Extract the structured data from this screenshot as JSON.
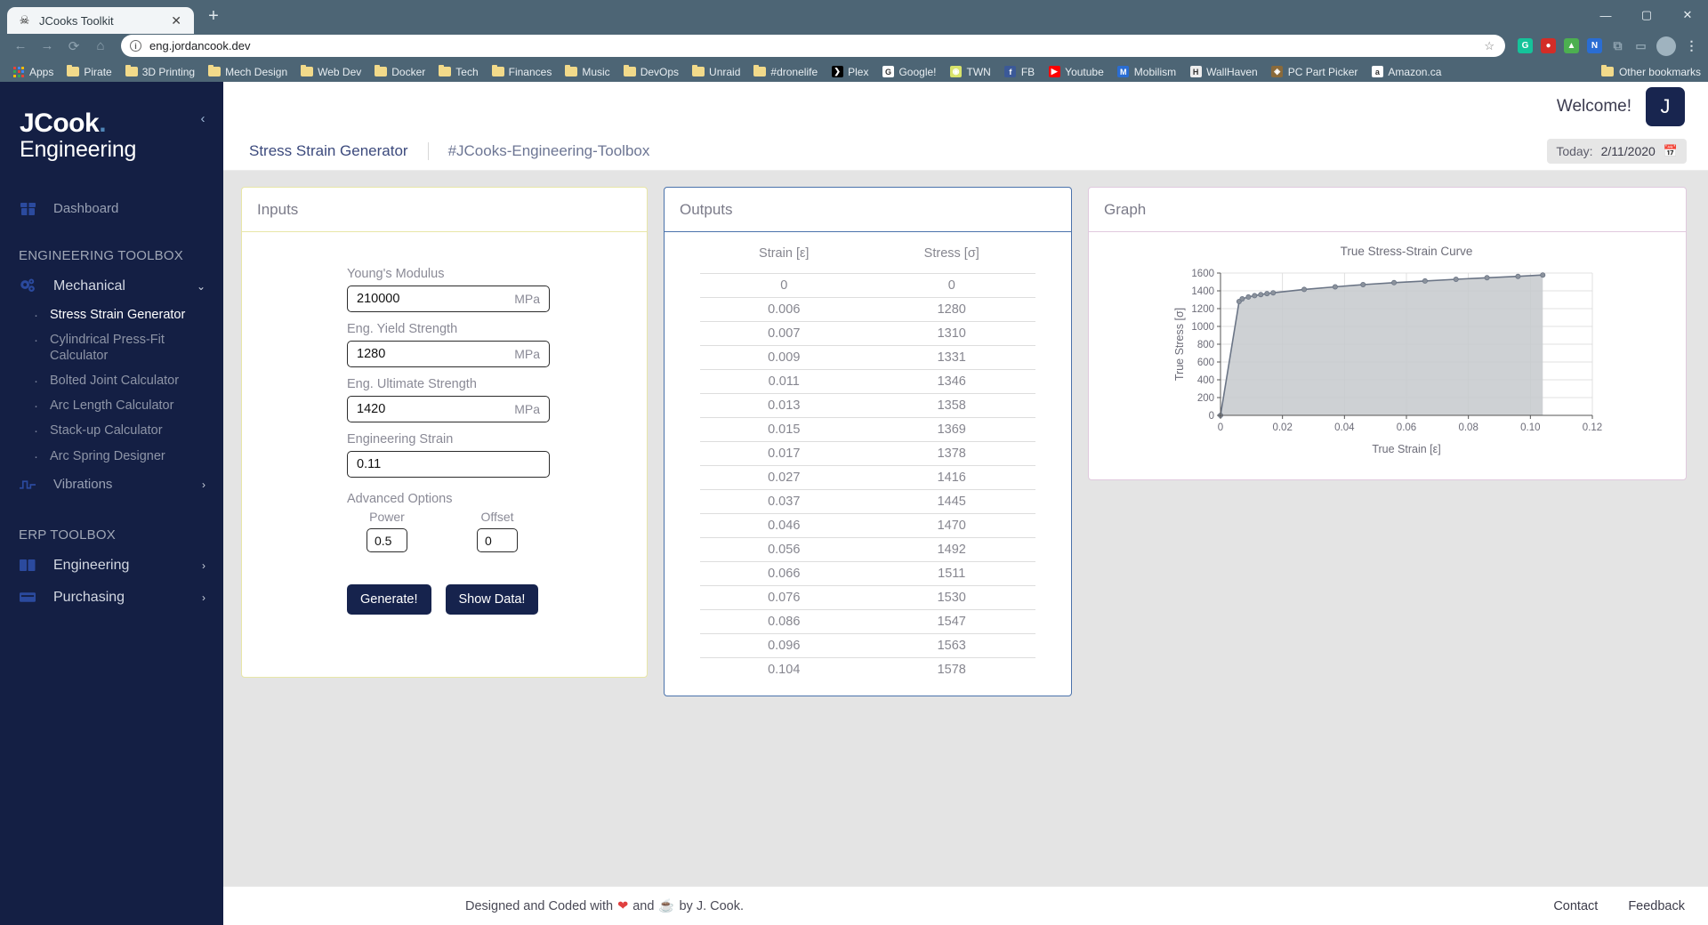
{
  "browser": {
    "tab": {
      "title": "JCooks Toolkit",
      "favicon": "skull-icon",
      "close": "✕"
    },
    "newtab_label": "+",
    "window_controls": [
      "minimize",
      "maximize",
      "close"
    ],
    "nav": {
      "back": "←",
      "forward": "→",
      "reload": "⟳",
      "home": "⌂"
    },
    "omnibox": {
      "url": "eng.jordancook.dev",
      "info_icon": "info-icon",
      "star": "☆"
    },
    "extensions": [
      "grammarly-icon",
      "lastpass-icon",
      "adblock-icon",
      "office-icon",
      "puzzle-icon",
      "cast-icon"
    ],
    "profile": "profile-avatar",
    "bookmarks": [
      {
        "label": "Apps",
        "icon": "apps-grid-icon"
      },
      {
        "label": "Pirate",
        "icon": "folder-icon"
      },
      {
        "label": "3D Printing",
        "icon": "folder-icon"
      },
      {
        "label": "Mech Design",
        "icon": "folder-icon"
      },
      {
        "label": "Web Dev",
        "icon": "folder-icon"
      },
      {
        "label": "Docker",
        "icon": "folder-icon"
      },
      {
        "label": "Tech",
        "icon": "folder-icon"
      },
      {
        "label": "Finances",
        "icon": "folder-icon"
      },
      {
        "label": "Music",
        "icon": "folder-icon"
      },
      {
        "label": "DevOps",
        "icon": "folder-icon"
      },
      {
        "label": "Unraid",
        "icon": "folder-icon"
      },
      {
        "label": "#dronelife",
        "icon": "folder-icon"
      },
      {
        "label": "Plex",
        "icon": "plex-icon"
      },
      {
        "label": "Google!",
        "icon": "google-icon"
      },
      {
        "label": "TWN",
        "icon": "twn-icon"
      },
      {
        "label": "FB",
        "icon": "facebook-icon"
      },
      {
        "label": "Youtube",
        "icon": "youtube-icon"
      },
      {
        "label": "Mobilism",
        "icon": "mobilism-icon"
      },
      {
        "label": "WallHaven",
        "icon": "wallhaven-icon"
      },
      {
        "label": "PC Part Picker",
        "icon": "pcpartpicker-icon"
      },
      {
        "label": "Amazon.ca",
        "icon": "amazon-icon"
      }
    ],
    "other_bookmarks": {
      "label": "Other bookmarks",
      "icon": "folder-icon"
    }
  },
  "sidebar": {
    "logo_line1": "JCook",
    "logo_dot": ".",
    "logo_line2": "Engineering",
    "collapse_icon": "chevron-left-icon",
    "dashboard": {
      "label": "Dashboard",
      "icon": "dashboard-icon"
    },
    "section_engineering": "ENGINEERING TOOLBOX",
    "mechanical": {
      "label": "Mechanical",
      "icon": "gears-icon",
      "chevron": "chevron-down-icon"
    },
    "mechanical_items": [
      "Stress Strain Generator",
      "Cylindrical Press-Fit Calculator",
      "Bolted Joint Calculator",
      "Arc Length Calculator",
      "Stack-up Calculator",
      "Arc Spring Designer"
    ],
    "vibrations": {
      "label": "Vibrations",
      "icon": "waveform-icon",
      "chevron": "chevron-right-icon"
    },
    "section_erp": "ERP TOOLBOX",
    "engineering": {
      "label": "Engineering",
      "icon": "book-icon",
      "chevron": "chevron-right-icon"
    },
    "purchasing": {
      "label": "Purchasing",
      "icon": "cart-icon",
      "chevron": "chevron-right-icon"
    }
  },
  "topbar": {
    "welcome": "Welcome!",
    "avatar_initial": "J"
  },
  "apptabs": {
    "primary": "Stress Strain Generator",
    "secondary": "#JCooks-Engineering-Toolbox",
    "today_label": "Today:",
    "today_value": "2/11/2020",
    "calendar_icon": "calendar-icon"
  },
  "inputs": {
    "title": "Inputs",
    "fields": [
      {
        "label": "Young's Modulus",
        "value": "210000",
        "unit": "MPa"
      },
      {
        "label": "Eng. Yield Strength",
        "value": "1280",
        "unit": "MPa"
      },
      {
        "label": "Eng. Ultimate Strength",
        "value": "1420",
        "unit": "MPa"
      },
      {
        "label": "Engineering Strain",
        "value": "0.11",
        "unit": ""
      }
    ],
    "advanced_label": "Advanced Options",
    "power": {
      "label": "Power",
      "value": "0.5"
    },
    "offset": {
      "label": "Offset",
      "value": "0"
    },
    "generate_btn": "Generate!",
    "showdata_btn": "Show Data!"
  },
  "outputs": {
    "title": "Outputs",
    "columns": [
      "Strain [ε]",
      "Stress [σ]"
    ],
    "rows": [
      [
        "0",
        "0"
      ],
      [
        "0.006",
        "1280"
      ],
      [
        "0.007",
        "1310"
      ],
      [
        "0.009",
        "1331"
      ],
      [
        "0.011",
        "1346"
      ],
      [
        "0.013",
        "1358"
      ],
      [
        "0.015",
        "1369"
      ],
      [
        "0.017",
        "1378"
      ],
      [
        "0.027",
        "1416"
      ],
      [
        "0.037",
        "1445"
      ],
      [
        "0.046",
        "1470"
      ],
      [
        "0.056",
        "1492"
      ],
      [
        "0.066",
        "1511"
      ],
      [
        "0.076",
        "1530"
      ],
      [
        "0.086",
        "1547"
      ],
      [
        "0.096",
        "1563"
      ],
      [
        "0.104",
        "1578"
      ]
    ]
  },
  "graph": {
    "title": "Graph"
  },
  "chart_data": {
    "type": "area",
    "title": "True Stress-Strain Curve",
    "xlabel": "True Strain [ε]",
    "ylabel": "True Stress [σ]",
    "xlim": [
      0,
      0.12
    ],
    "ylim": [
      0,
      1600
    ],
    "xticks": [
      0,
      0.02,
      0.04,
      0.06,
      0.08,
      0.1,
      0.12
    ],
    "xticklabels": [
      "0",
      "0.02",
      "0.04",
      "0.06",
      "0.08",
      "0.10",
      "0.12"
    ],
    "yticks": [
      0,
      200,
      400,
      600,
      800,
      1000,
      1200,
      1400,
      1600
    ],
    "yticklabels": [
      "0",
      "200",
      "400",
      "600",
      "800",
      "1000",
      "1200",
      "1400",
      "1600"
    ],
    "grid": true,
    "legend": false,
    "marker": "circle",
    "line_color": "#6b7586",
    "fill_color": "#c6c9cd",
    "x": [
      0,
      0.006,
      0.007,
      0.009,
      0.011,
      0.013,
      0.015,
      0.017,
      0.027,
      0.037,
      0.046,
      0.056,
      0.066,
      0.076,
      0.086,
      0.096,
      0.104
    ],
    "y": [
      0,
      1280,
      1310,
      1331,
      1346,
      1358,
      1369,
      1378,
      1416,
      1445,
      1470,
      1492,
      1511,
      1530,
      1547,
      1563,
      1578
    ]
  },
  "footer": {
    "text_pre": "Designed and Coded with",
    "heart": "❤",
    "text_mid": "and",
    "coffee": "☕",
    "text_post": "by J. Cook.",
    "contact": "Contact",
    "feedback": "Feedback"
  }
}
